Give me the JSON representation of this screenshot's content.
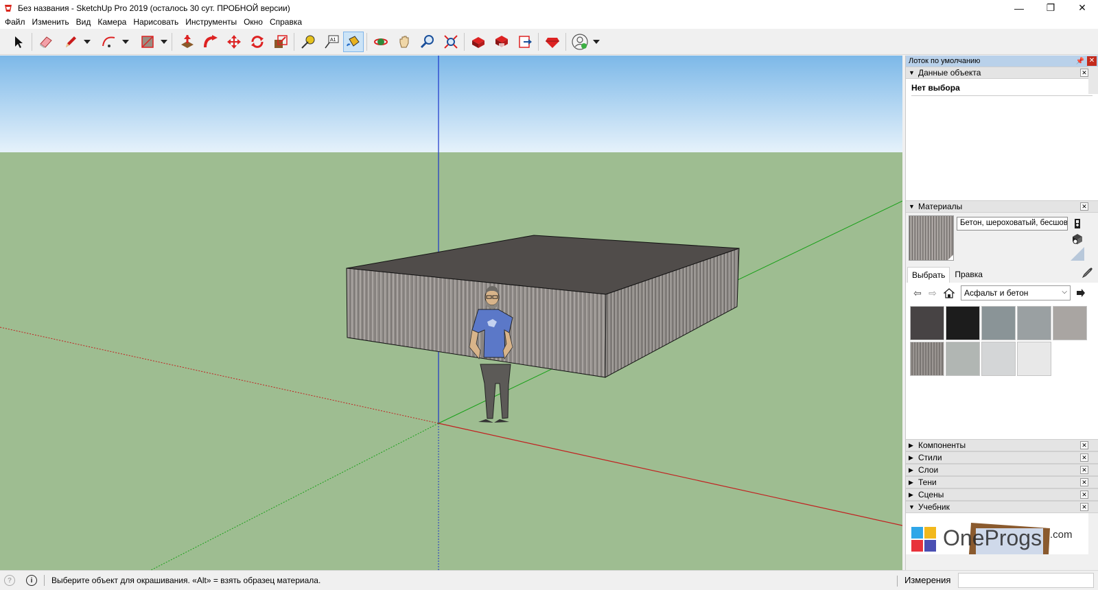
{
  "window": {
    "title": "Без названия - SketchUp Pro 2019 (осталось 30 сут. ПРОБНОЙ версии)",
    "minimize": "—",
    "restore": "❐",
    "close": "✕"
  },
  "menu": [
    "Файл",
    "Изменить",
    "Вид",
    "Камера",
    "Нарисовать",
    "Инструменты",
    "Окно",
    "Справка"
  ],
  "toolbar": {
    "tools": [
      "select-icon",
      "eraser-icon",
      "pencil-icon",
      "arc-icon",
      "rectangle-icon",
      "push-pull-icon",
      "follow-me-icon",
      "move-icon",
      "rotate-icon",
      "scale-icon",
      "tape-measure-icon",
      "text-icon",
      "paint-bucket-icon",
      "orbit-icon",
      "pan-icon",
      "zoom-icon",
      "zoom-extents-icon",
      "warehouse-icon",
      "extension-warehouse-icon",
      "send-to-layout-icon",
      "extension-manager-icon",
      "profile-icon"
    ],
    "text_label": "A1",
    "active_tool": "paint-bucket-icon"
  },
  "statusbar": {
    "hint": "Выберите объект для окрашивания. «Alt» = взять образец материала.",
    "measurements_label": "Измерения",
    "measurements_value": ""
  },
  "tray": {
    "title": "Лоток по умолчанию",
    "entity_info": {
      "title": "Данные объекта",
      "selection": "Нет выбора"
    },
    "materials": {
      "title": "Материалы",
      "name": "Бетон, шероховатый, бесшовн",
      "tabs": [
        "Выбрать",
        "Правка"
      ],
      "active_tab": "Выбрать",
      "library": "Асфальт и бетон",
      "swatch_count": 9
    },
    "collapsed_panels": [
      "Компоненты",
      "Стили",
      "Слои",
      "Тени",
      "Сцены"
    ],
    "tutorial": {
      "title": "Учебник"
    }
  },
  "watermark": {
    "text": "OneProgs",
    "suffix": ".com"
  },
  "colors": {
    "sky_top": "#7cb8e8",
    "sky_bottom": "#e6f2fb",
    "ground": "#9ebd91",
    "axis_red": "#c21e1e",
    "axis_green": "#17a017",
    "axis_blue": "#1b33c9",
    "tray_title": "#b9d1ea",
    "active_tool_bg": "#cce4f7"
  }
}
